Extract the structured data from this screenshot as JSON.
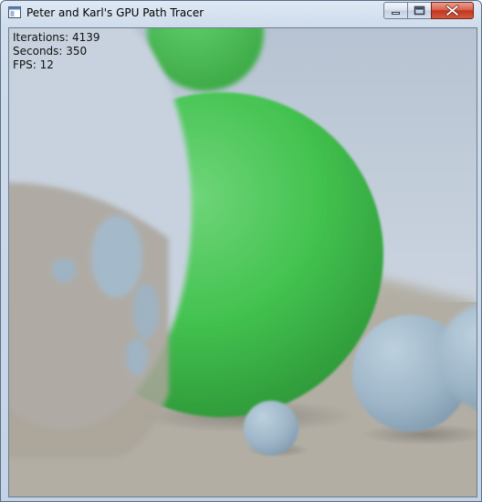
{
  "window": {
    "title": "Peter and Karl's GPU Path Tracer",
    "icon": "app-window-icon",
    "buttons": {
      "minimize": "minimize-icon",
      "maximize": "maximize-icon",
      "close": "close-icon"
    }
  },
  "stats": {
    "iterations": "Iterations: 4139",
    "seconds": "Seconds: 350",
    "fps": "FPS: 12"
  },
  "colors": {
    "close_red": "#c9432a",
    "sphere_green": "#3fc24e",
    "sphere_blue": "#9fb6c8",
    "floor": "#b3aea3",
    "sky": "#c3cfdd"
  }
}
